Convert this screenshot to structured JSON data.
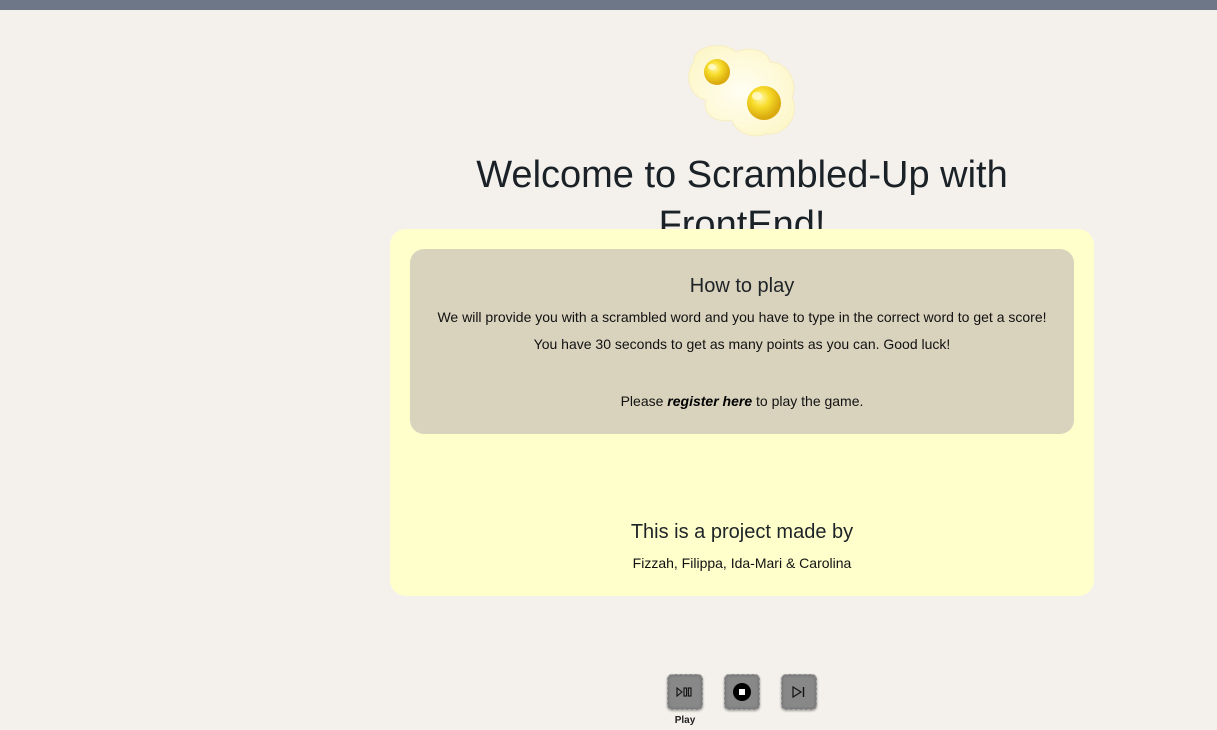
{
  "header": {
    "title": "Welcome to Scrambled-Up with FrontEnd!"
  },
  "logo": {
    "icon": "fried-eggs-logo",
    "yolk_color": "#f5d51c",
    "white_color": "#fffbdc"
  },
  "instructions": {
    "heading": "How to play",
    "line1": "We will provide you with a scrambled word and you have to type in the correct word to get a score!",
    "line2": "You have 30 seconds to get as many points as you can. Good luck!",
    "register_prefix": "Please ",
    "register_link": "register here",
    "register_suffix": " to play the game."
  },
  "credits": {
    "heading": "This is a project made by",
    "names": "Fizzah, Filippa, Ida-Mari & Carolina"
  },
  "player": {
    "play_label": "Play",
    "buttons": [
      {
        "icon": "play-pause-icon"
      },
      {
        "icon": "stop-icon"
      },
      {
        "icon": "skip-next-icon"
      }
    ]
  },
  "colors": {
    "page_background": "#f4f1ec",
    "top_bar": "#6e7788",
    "card_background": "#ffffcc",
    "inner_card_background": "#d9d2bd",
    "button_background": "#888888"
  }
}
